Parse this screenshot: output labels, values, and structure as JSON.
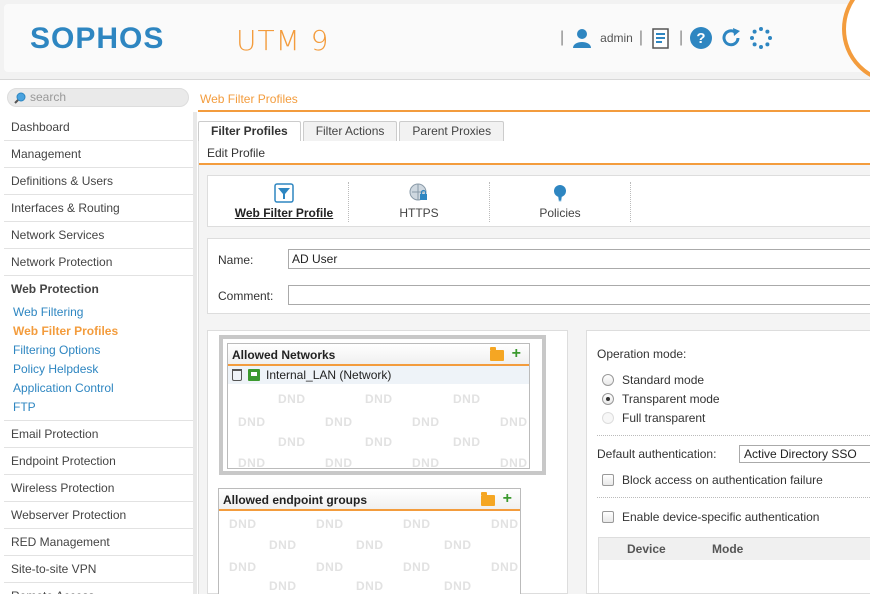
{
  "header": {
    "logo": "SOPHOS",
    "product": "UTM 9",
    "user": "admin",
    "icons": [
      "user-icon",
      "notepad-icon",
      "help-icon",
      "reload-icon",
      "spinner-icon"
    ]
  },
  "search": {
    "placeholder": "search"
  },
  "breadcrumb": "Web Filter Profiles",
  "sidebar": {
    "items_top": [
      "Dashboard",
      "Management",
      "Definitions & Users",
      "Interfaces & Routing",
      "Network Services",
      "Network Protection"
    ],
    "active_section": "Web Protection",
    "sub_items": [
      "Web Filtering",
      "Web Filter Profiles",
      "Filtering Options",
      "Policy Helpdesk",
      "Application Control",
      "FTP"
    ],
    "current_sub": "Web Filter Profiles",
    "items_bottom": [
      "Email Protection",
      "Endpoint Protection",
      "Wireless Protection",
      "Webserver Protection",
      "RED Management",
      "Site-to-site VPN",
      "Remote Access"
    ]
  },
  "tabs": [
    "Filter Profiles",
    "Filter Actions",
    "Parent Proxies"
  ],
  "edit": {
    "title": "Edit Profile",
    "subtabs": [
      "Web Filter Profile",
      "HTTPS",
      "Policies"
    ],
    "name_label": "Name:",
    "name_value": "AD User",
    "comment_label": "Comment:",
    "comment_value": ""
  },
  "allowed_networks": {
    "title": "Allowed Networks",
    "items": [
      "Internal_LAN (Network)"
    ],
    "dnd": "DND"
  },
  "allowed_endpoints": {
    "title": "Allowed endpoint groups",
    "dnd": "DND"
  },
  "operation": {
    "label": "Operation mode:",
    "options": [
      "Standard mode",
      "Transparent mode",
      "Full transparent"
    ],
    "selected": "Transparent mode",
    "default_auth_label": "Default authentication:",
    "default_auth_value": "Active Directory SSO",
    "block_label": "Block access on authentication failure",
    "device_auth_label": "Enable device-specific authentication",
    "table_headers": [
      "Device",
      "Mode"
    ]
  },
  "colors": {
    "accent": "#f39c3d",
    "brand": "#2e86c1",
    "link": "#2e86c1",
    "green": "#3c9a2f"
  }
}
